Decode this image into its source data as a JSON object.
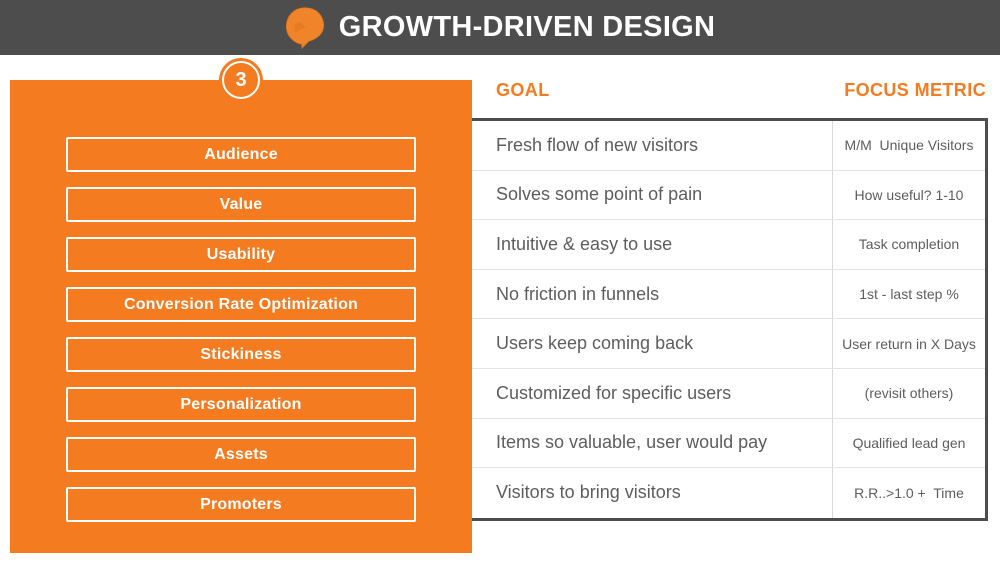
{
  "header": {
    "title": "GROWTH-DRIVEN DESIGN",
    "logo_icon": "sprout-spiral-logo-icon",
    "bar_color": "#4d4d4d",
    "title_color": "#ffffff",
    "logo_color": "#f47b20"
  },
  "step": {
    "number": "3",
    "badge_color": "#f47b20",
    "badge_text_color": "#ffffff"
  },
  "panel": {
    "background_color": "#f47b20",
    "pillars": [
      {
        "label": "Audience"
      },
      {
        "label": "Value"
      },
      {
        "label": "Usability"
      },
      {
        "label": "Conversion Rate Optimization"
      },
      {
        "label": "Stickiness"
      },
      {
        "label": "Personalization"
      },
      {
        "label": "Assets"
      },
      {
        "label": "Promoters"
      }
    ]
  },
  "table": {
    "columns": [
      "GOAL",
      "FOCUS METRIC"
    ],
    "header_color": "#f47b20",
    "text_color": "#5d5d5d",
    "rows": [
      {
        "goal": "Fresh flow of new visitors",
        "metric": "M/M  Unique Visitors"
      },
      {
        "goal": "Solves some point of pain",
        "metric": "How useful? 1-10"
      },
      {
        "goal": "Intuitive & easy to use",
        "metric": "Task completion"
      },
      {
        "goal": "No friction in funnels",
        "metric": "1st - last step %"
      },
      {
        "goal": "Users keep coming back",
        "metric": "User return in X Days"
      },
      {
        "goal": "Customized for specific users",
        "metric": "(revisit others)"
      },
      {
        "goal": "Items so valuable, user would pay",
        "metric": "Qualified lead gen"
      },
      {
        "goal": "Visitors to bring visitors",
        "metric": "R.R..>1.0 +  Time"
      }
    ]
  }
}
